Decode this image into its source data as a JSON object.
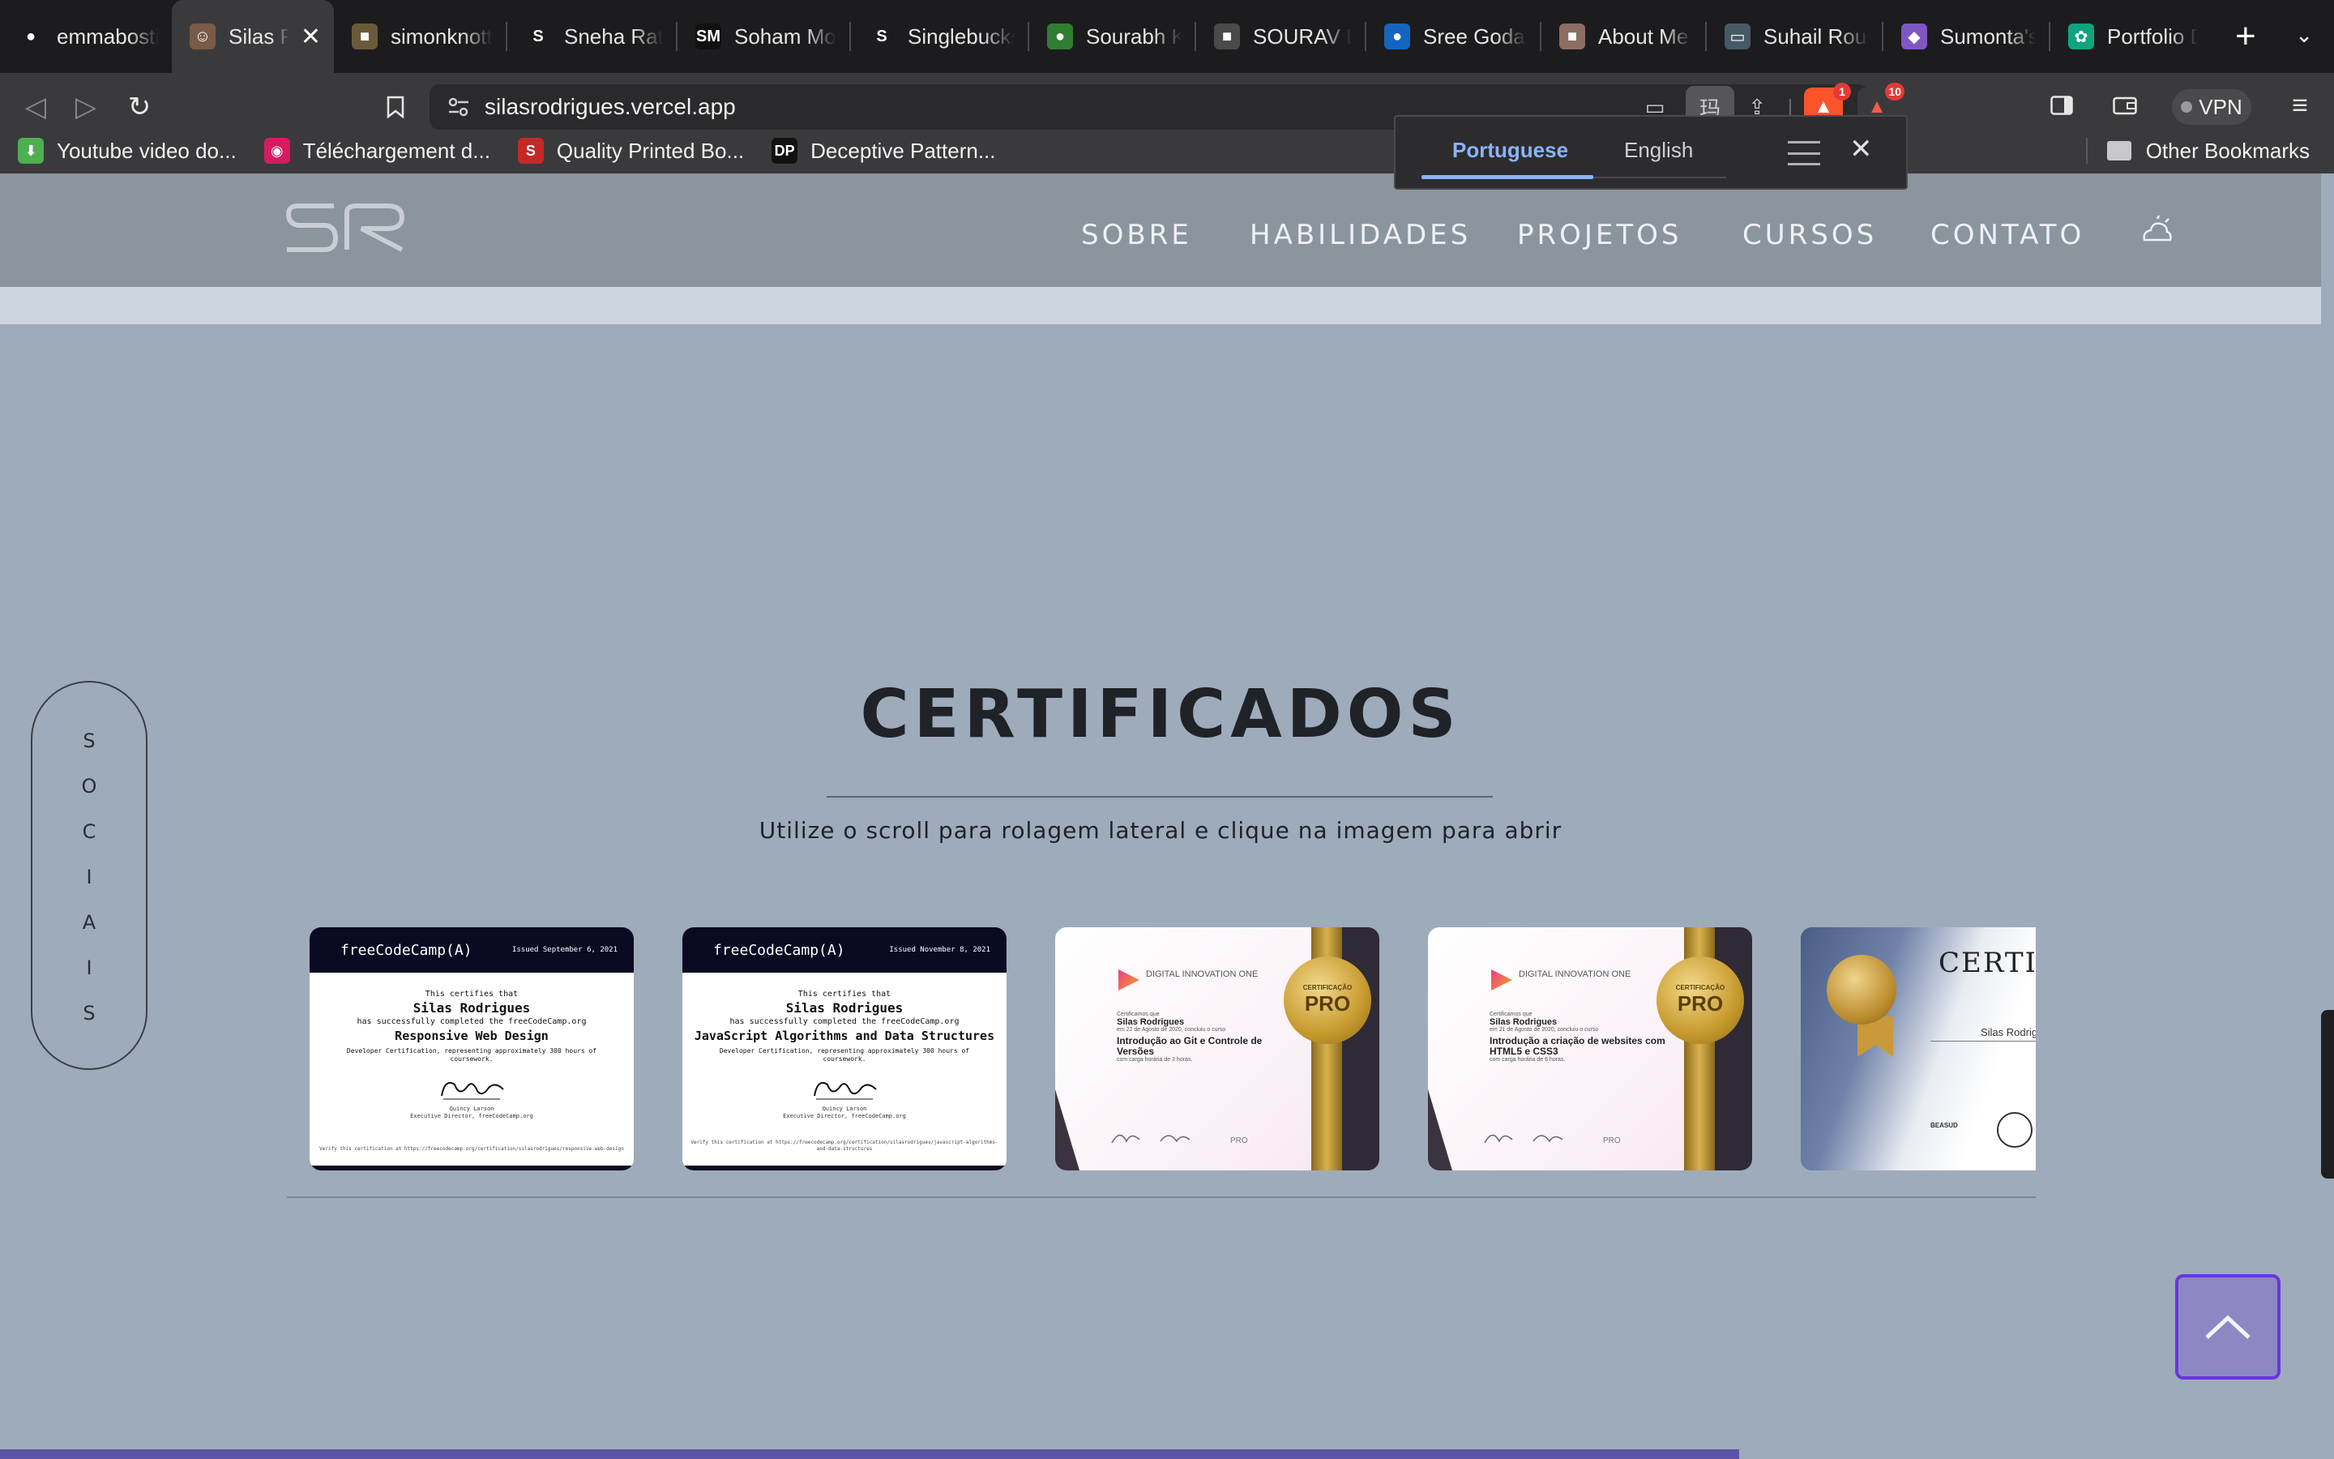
{
  "browser": {
    "tabs": [
      {
        "label": "emmabosti",
        "icon": "github-icon",
        "color": "#1c1c1e",
        "glyph": "●"
      },
      {
        "label": "Silas R",
        "icon": "avatar-icon",
        "color": "#7a5a48",
        "glyph": "☺",
        "active": true
      },
      {
        "label": "simonknott",
        "icon": "avatar-icon",
        "color": "#6b5a3a",
        "glyph": "■"
      },
      {
        "label": "Sneha Ratn",
        "icon": "letter-s-icon",
        "color": "#1c1c1e",
        "glyph": "S"
      },
      {
        "label": "Soham Mor",
        "icon": "sm-logo-icon",
        "color": "#111111",
        "glyph": "SM"
      },
      {
        "label": "Singlebucks",
        "icon": "singlebucks-icon",
        "color": "#1c1c1e",
        "glyph": "S"
      },
      {
        "label": "Sourabh Ko",
        "icon": "tree-icon",
        "color": "#2e7d32",
        "glyph": "●"
      },
      {
        "label": "SOURAV DU",
        "icon": "avatar-icon",
        "color": "#4a4a4a",
        "glyph": "■"
      },
      {
        "label": "Sree Godav",
        "icon": "user-circle-icon",
        "color": "#1565c0",
        "glyph": "●"
      },
      {
        "label": "About Me |",
        "icon": "avatar-icon",
        "color": "#8d6e63",
        "glyph": "■"
      },
      {
        "label": "Suhail Rous",
        "icon": "monitor-icon",
        "color": "#455a64",
        "glyph": "▭"
      },
      {
        "label": "Sumonta's",
        "icon": "avatar-icon",
        "color": "#7e57c2",
        "glyph": "◆"
      },
      {
        "label": "Portfolio De",
        "icon": "openai-icon",
        "color": "#10a37f",
        "glyph": "✿"
      }
    ],
    "url": "silasrodrigues.vercel.app",
    "shields_count": "1",
    "rewards_count": "10",
    "vpn_label": "VPN",
    "bookmarks": [
      {
        "label": "Youtube video do...",
        "icon": "download-arrow-icon",
        "color": "#4caf50",
        "glyph": "⬇"
      },
      {
        "label": "Téléchargement d...",
        "icon": "pink-app-icon",
        "color": "#d81b60",
        "glyph": "◉"
      },
      {
        "label": "Quality Printed Bo...",
        "icon": "letter-s-icon",
        "color": "#c62828",
        "glyph": "S"
      },
      {
        "label": "Deceptive Pattern...",
        "icon": "dp-logo-icon",
        "color": "#111111",
        "glyph": "DP"
      }
    ],
    "other_bookmarks": "Other Bookmarks"
  },
  "translate_popup": {
    "source_lang": "Portuguese",
    "target_lang": "English"
  },
  "site": {
    "nav": [
      "SOBRE",
      "HABILIDADES",
      "PROJETOS",
      "CURSOS",
      "CONTATO"
    ],
    "socials_letters": [
      "S",
      "O",
      "C",
      "I",
      "A",
      "I",
      "S"
    ],
    "section_title": "CERTIFICADOS",
    "section_subtitle": "Utilize o scroll para rolagem lateral e clique na imagem para abrir"
  },
  "certificates": {
    "fcc": [
      {
        "brand": "freeCodeCamp(A)",
        "issued": "Issued September 6, 2021",
        "certifies": "This certifies that",
        "name": "Silas Rodrigues",
        "completed": "has successfully completed the freeCodeCamp.org",
        "course": "Responsive Web Design",
        "hours": "Developer Certification, representing approximately 300 hours of coursework.",
        "signer": "Quincy Larson",
        "signer_title": "Executive Director, freeCodeCamp.org",
        "verify": "Verify this certification at https://freecodecamp.org/certification/silasrodrigues/responsive-web-design"
      },
      {
        "brand": "freeCodeCamp(A)",
        "issued": "Issued November 8, 2021",
        "certifies": "This certifies that",
        "name": "Silas Rodrigues",
        "completed": "has successfully completed the freeCodeCamp.org",
        "course": "JavaScript Algorithms and Data Structures",
        "hours": "Developer Certification, representing approximately 300 hours of coursework.",
        "signer": "Quincy Larson",
        "signer_title": "Executive Director, freeCodeCamp.org",
        "verify": "Verify this certification at https://freecodecamp.org/certification/silasrodrigues/javascript-algorithms-and-data-structures"
      }
    ],
    "dio": [
      {
        "logo": "DIGITAL INNOVATION ONE",
        "certify": "Certificamos que",
        "name": "Silas Rodrigues",
        "date": "em 22 de Agosto de 2020, concluiu o curso",
        "course": "Introdução ao Git e Controle de Versões",
        "hours": "com carga horária de 2 horas.",
        "seal_top": "CERTIFICAÇÃO",
        "seal": "PRO",
        "footer_badge": "PRO"
      },
      {
        "logo": "DIGITAL INNOVATION ONE",
        "certify": "Certificamos que",
        "name": "Silas Rodrigues",
        "date": "em 21 de Agosto de 2020, concluiu o curso",
        "course": "Introdução a criação de websites com HTML5 e CSS3",
        "hours": "com carga horária de 6 horas.",
        "seal_top": "CERTIFICAÇÃO",
        "seal": "PRO",
        "footer_badge": "PRO"
      }
    ],
    "award": {
      "title": "CERTIF",
      "name": "Silas Rodrig",
      "footer": "BEASUD"
    }
  }
}
